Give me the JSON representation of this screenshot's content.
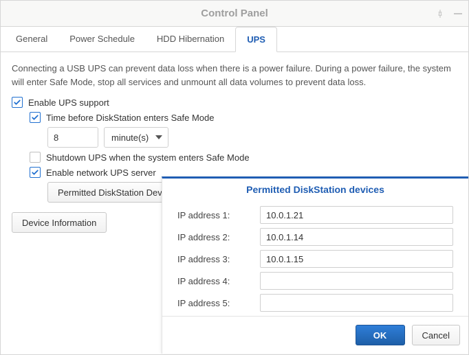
{
  "window": {
    "title": "Control Panel"
  },
  "tabs": [
    {
      "label": "General"
    },
    {
      "label": "Power Schedule"
    },
    {
      "label": "HDD Hibernation"
    },
    {
      "label": "UPS",
      "active": true
    }
  ],
  "intro": "Connecting a USB UPS can prevent data loss when there is a power failure. During a power failure, the system will enter Safe Mode, stop all services and unmount all data volumes to prevent data loss.",
  "ups": {
    "enable_label": "Enable UPS support",
    "time_before_label": "Time before DiskStation enters Safe Mode",
    "time_value": "8",
    "time_unit": "minute(s)",
    "shutdown_label": "Shutdown UPS when the system enters Safe Mode",
    "network_server_label": "Enable network UPS server",
    "permitted_button": "Permitted DiskStation Devices",
    "device_info_button": "Device Information"
  },
  "dialog": {
    "title": "Permitted DiskStation devices",
    "rows": [
      {
        "label": "IP address 1:",
        "value": "10.0.1.21"
      },
      {
        "label": "IP address 2:",
        "value": "10.0.1.14"
      },
      {
        "label": "IP address 3:",
        "value": "10.0.1.15"
      },
      {
        "label": "IP address 4:",
        "value": ""
      },
      {
        "label": "IP address 5:",
        "value": ""
      }
    ],
    "ok": "OK",
    "cancel": "Cancel"
  }
}
